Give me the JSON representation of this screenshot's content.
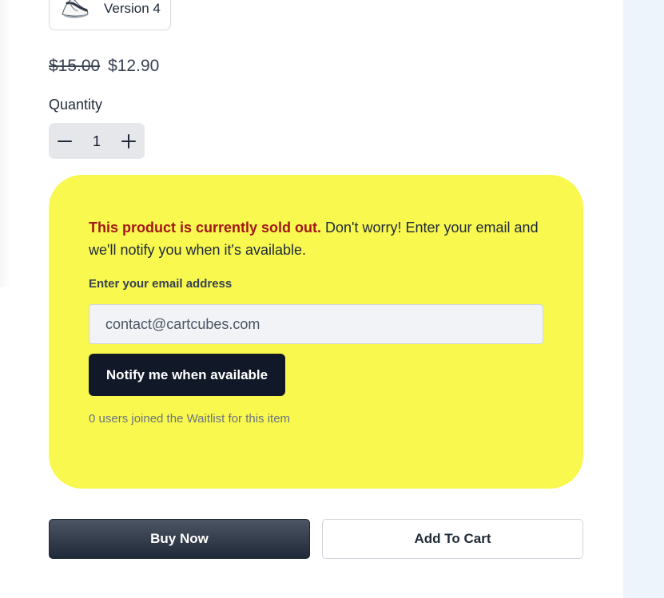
{
  "variant": {
    "label": "Version 4",
    "thumbnail_icon": "sneaker-icon"
  },
  "price": {
    "original": "$15.00",
    "current": "$12.90"
  },
  "quantity": {
    "label": "Quantity",
    "value": "1",
    "decrement_icon": "minus-icon",
    "increment_icon": "plus-icon"
  },
  "waitlist": {
    "sold_out_text": "This product is currently sold out.",
    "message_text": " Don't worry! Enter your email and we'll notify you when it's available.",
    "email_label": "Enter your email address",
    "email_placeholder": "contact@cartcubes.com",
    "notify_label": "Notify me when available",
    "count_text": "0 users joined the Waitlist for this item",
    "background_color": "#f8f84f",
    "alert_color": "#a31717"
  },
  "actions": {
    "buy_now_label": "Buy Now",
    "add_to_cart_label": "Add To Cart"
  }
}
